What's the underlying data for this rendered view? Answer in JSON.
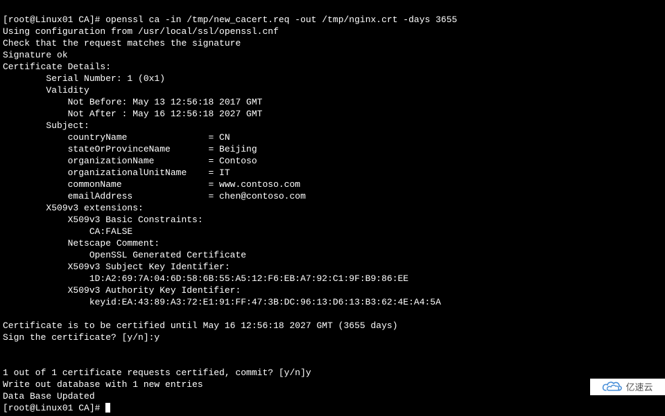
{
  "prompt1": "[root@Linux01 CA]# ",
  "command": "openssl ca -in /tmp/new_cacert.req -out /tmp/nginx.crt -days 3655",
  "line_config": "Using configuration from /usr/local/ssl/openssl.cnf",
  "line_check": "Check that the request matches the signature",
  "line_sigok": "Signature ok",
  "line_cert_details": "Certificate Details:",
  "line_serial": "        Serial Number: 1 (0x1)",
  "line_validity": "        Validity",
  "line_not_before": "            Not Before: May 13 12:56:18 2017 GMT",
  "line_not_after": "            Not After : May 16 12:56:18 2027 GMT",
  "line_subject": "        Subject:",
  "line_country": "            countryName               = CN",
  "line_state": "            stateOrProvinceName       = Beijing",
  "line_org": "            organizationName          = Contoso",
  "line_ou": "            organizationalUnitName    = IT",
  "line_cn": "            commonName                = www.contoso.com",
  "line_email": "            emailAddress              = chen@contoso.com",
  "line_x509_ext": "        X509v3 extensions:",
  "line_basic": "            X509v3 Basic Constraints: ",
  "line_ca_false": "                CA:FALSE",
  "line_netscape": "            Netscape Comment: ",
  "line_openssl_gen": "                OpenSSL Generated Certificate",
  "line_ski": "            X509v3 Subject Key Identifier: ",
  "line_ski_val": "                1D:A2:69:7A:04:6D:58:6B:55:A5:12:F6:EB:A7:92:C1:9F:B9:86:EE",
  "line_aki": "            X509v3 Authority Key Identifier: ",
  "line_aki_val": "                keyid:EA:43:89:A3:72:E1:91:FF:47:3B:DC:96:13:D6:13:B3:62:4E:A4:5A",
  "line_blank1": "",
  "line_certified_until": "Certificate is to be certified until May 16 12:56:18 2027 GMT (3655 days)",
  "line_sign_prompt": "Sign the certificate? [y/n]:y",
  "line_blank2": "",
  "line_blank3": "",
  "line_commit_prompt": "1 out of 1 certificate requests certified, commit? [y/n]y",
  "line_writeout": "Write out database with 1 new entries",
  "line_db_updated": "Data Base Updated",
  "prompt2": "[root@Linux01 CA]# ",
  "watermark_text": "亿速云"
}
